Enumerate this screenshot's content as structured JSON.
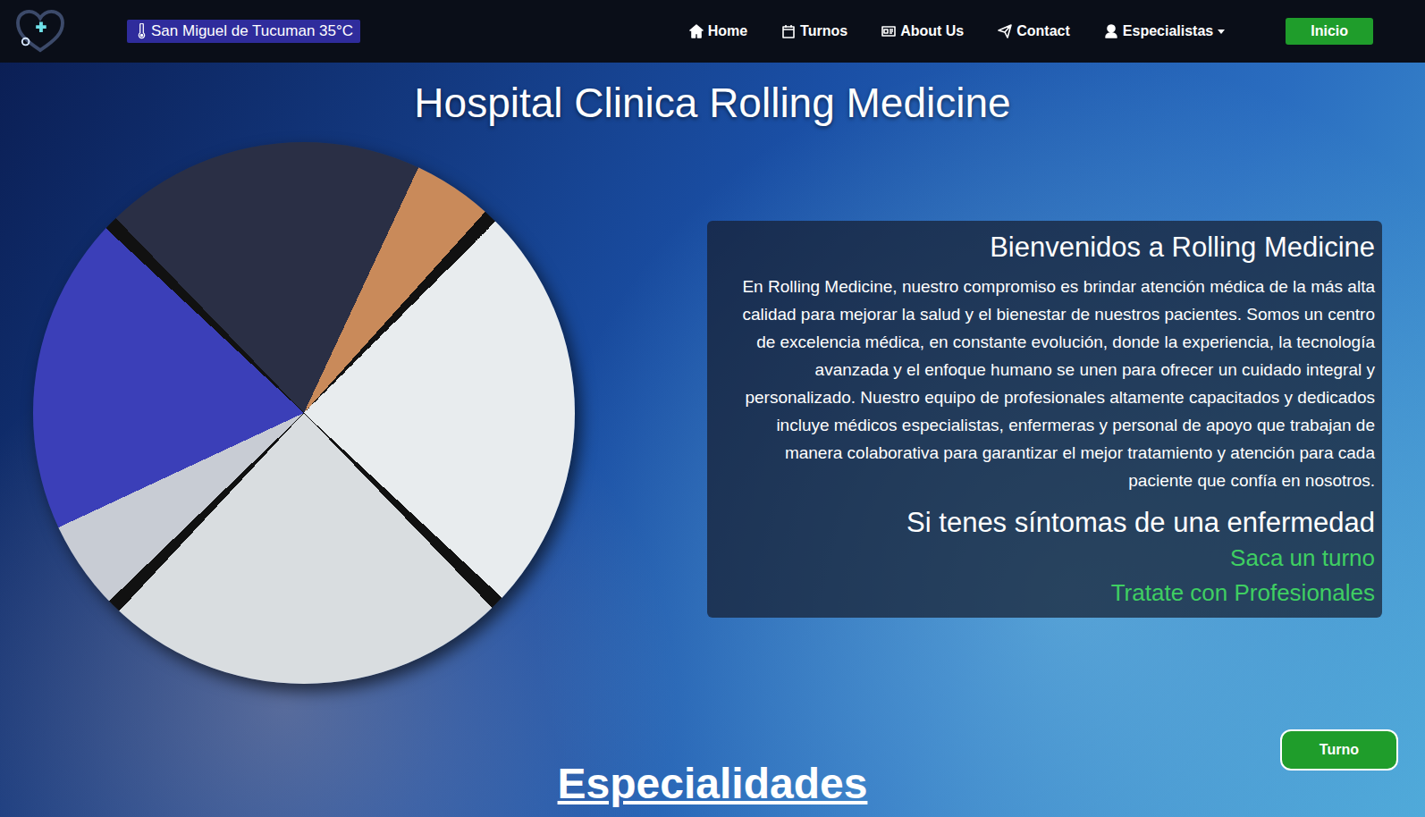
{
  "weather": {
    "text": "San Miguel de Tucuman 35°C"
  },
  "nav": {
    "items": [
      {
        "label": "Home",
        "dropdown": false
      },
      {
        "label": "Turnos",
        "dropdown": false
      },
      {
        "label": "About Us",
        "dropdown": false
      },
      {
        "label": "Contact",
        "dropdown": false
      },
      {
        "label": "Especialistas",
        "dropdown": true
      }
    ]
  },
  "login_button": "Inicio",
  "hero": {
    "title": "Hospital Clinica Rolling Medicine",
    "welcome": "Bienvenidos a Rolling Medicine",
    "paragraph": "En Rolling Medicine, nuestro compromiso es brindar atención médica de la más alta calidad para mejorar la salud y el bienestar de nuestros pacientes. Somos un centro de excelencia médica, en constante evolución, donde la experiencia, la tecnología avanzada y el enfoque humano se unen para ofrecer un cuidado integral y personalizado. Nuestro equipo de profesionales altamente capacitados y dedicados incluye médicos especialistas, enfermeras y personal de apoyo que trabajan de manera colaborativa para garantizar el mejor tratamiento y atención para cada paciente que confía en nosotros.",
    "prompt": "Si tenes síntomas de una enfermedad",
    "actions": [
      "Saca un turno",
      "Tratate con Profesionales"
    ]
  },
  "section_title": "Especialidades",
  "float_button": "Turno"
}
